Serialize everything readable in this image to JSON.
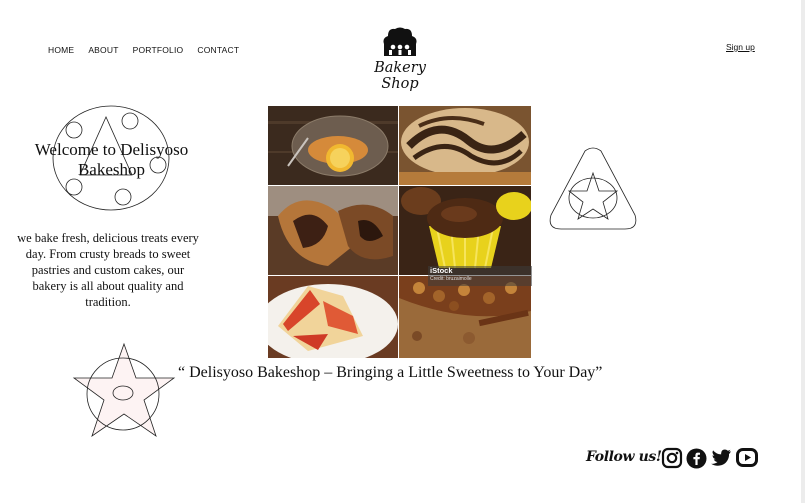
{
  "nav": {
    "items": [
      "HOME",
      "ABOUT",
      "PORTFOLIO",
      "CONTACT"
    ],
    "signup": "Sign up"
  },
  "brand": {
    "name": "Bakery Shop",
    "logo_icon": "chef-hat-icon"
  },
  "hero": {
    "title": "Welcome to Delisyoso Bakeshop",
    "intro": "we bake fresh, delicious treats every day. From crusty breads to sweet pastries and custom cakes, our bakery is all about quality and tradition."
  },
  "gallery": {
    "watermark": "iStock",
    "credit": "Credit: bruzaimolle"
  },
  "quote": "“ Delisyoso Bakeshop – Bringing a Little Sweetness to Your Day”",
  "follow": {
    "label": "Follow us!",
    "icons": [
      "instagram-icon",
      "facebook-icon",
      "twitter-icon",
      "youtube-icon"
    ]
  },
  "colors": {
    "text": "#111111",
    "background": "#ffffff",
    "cupcake_wrapper": "#e8d21c"
  }
}
